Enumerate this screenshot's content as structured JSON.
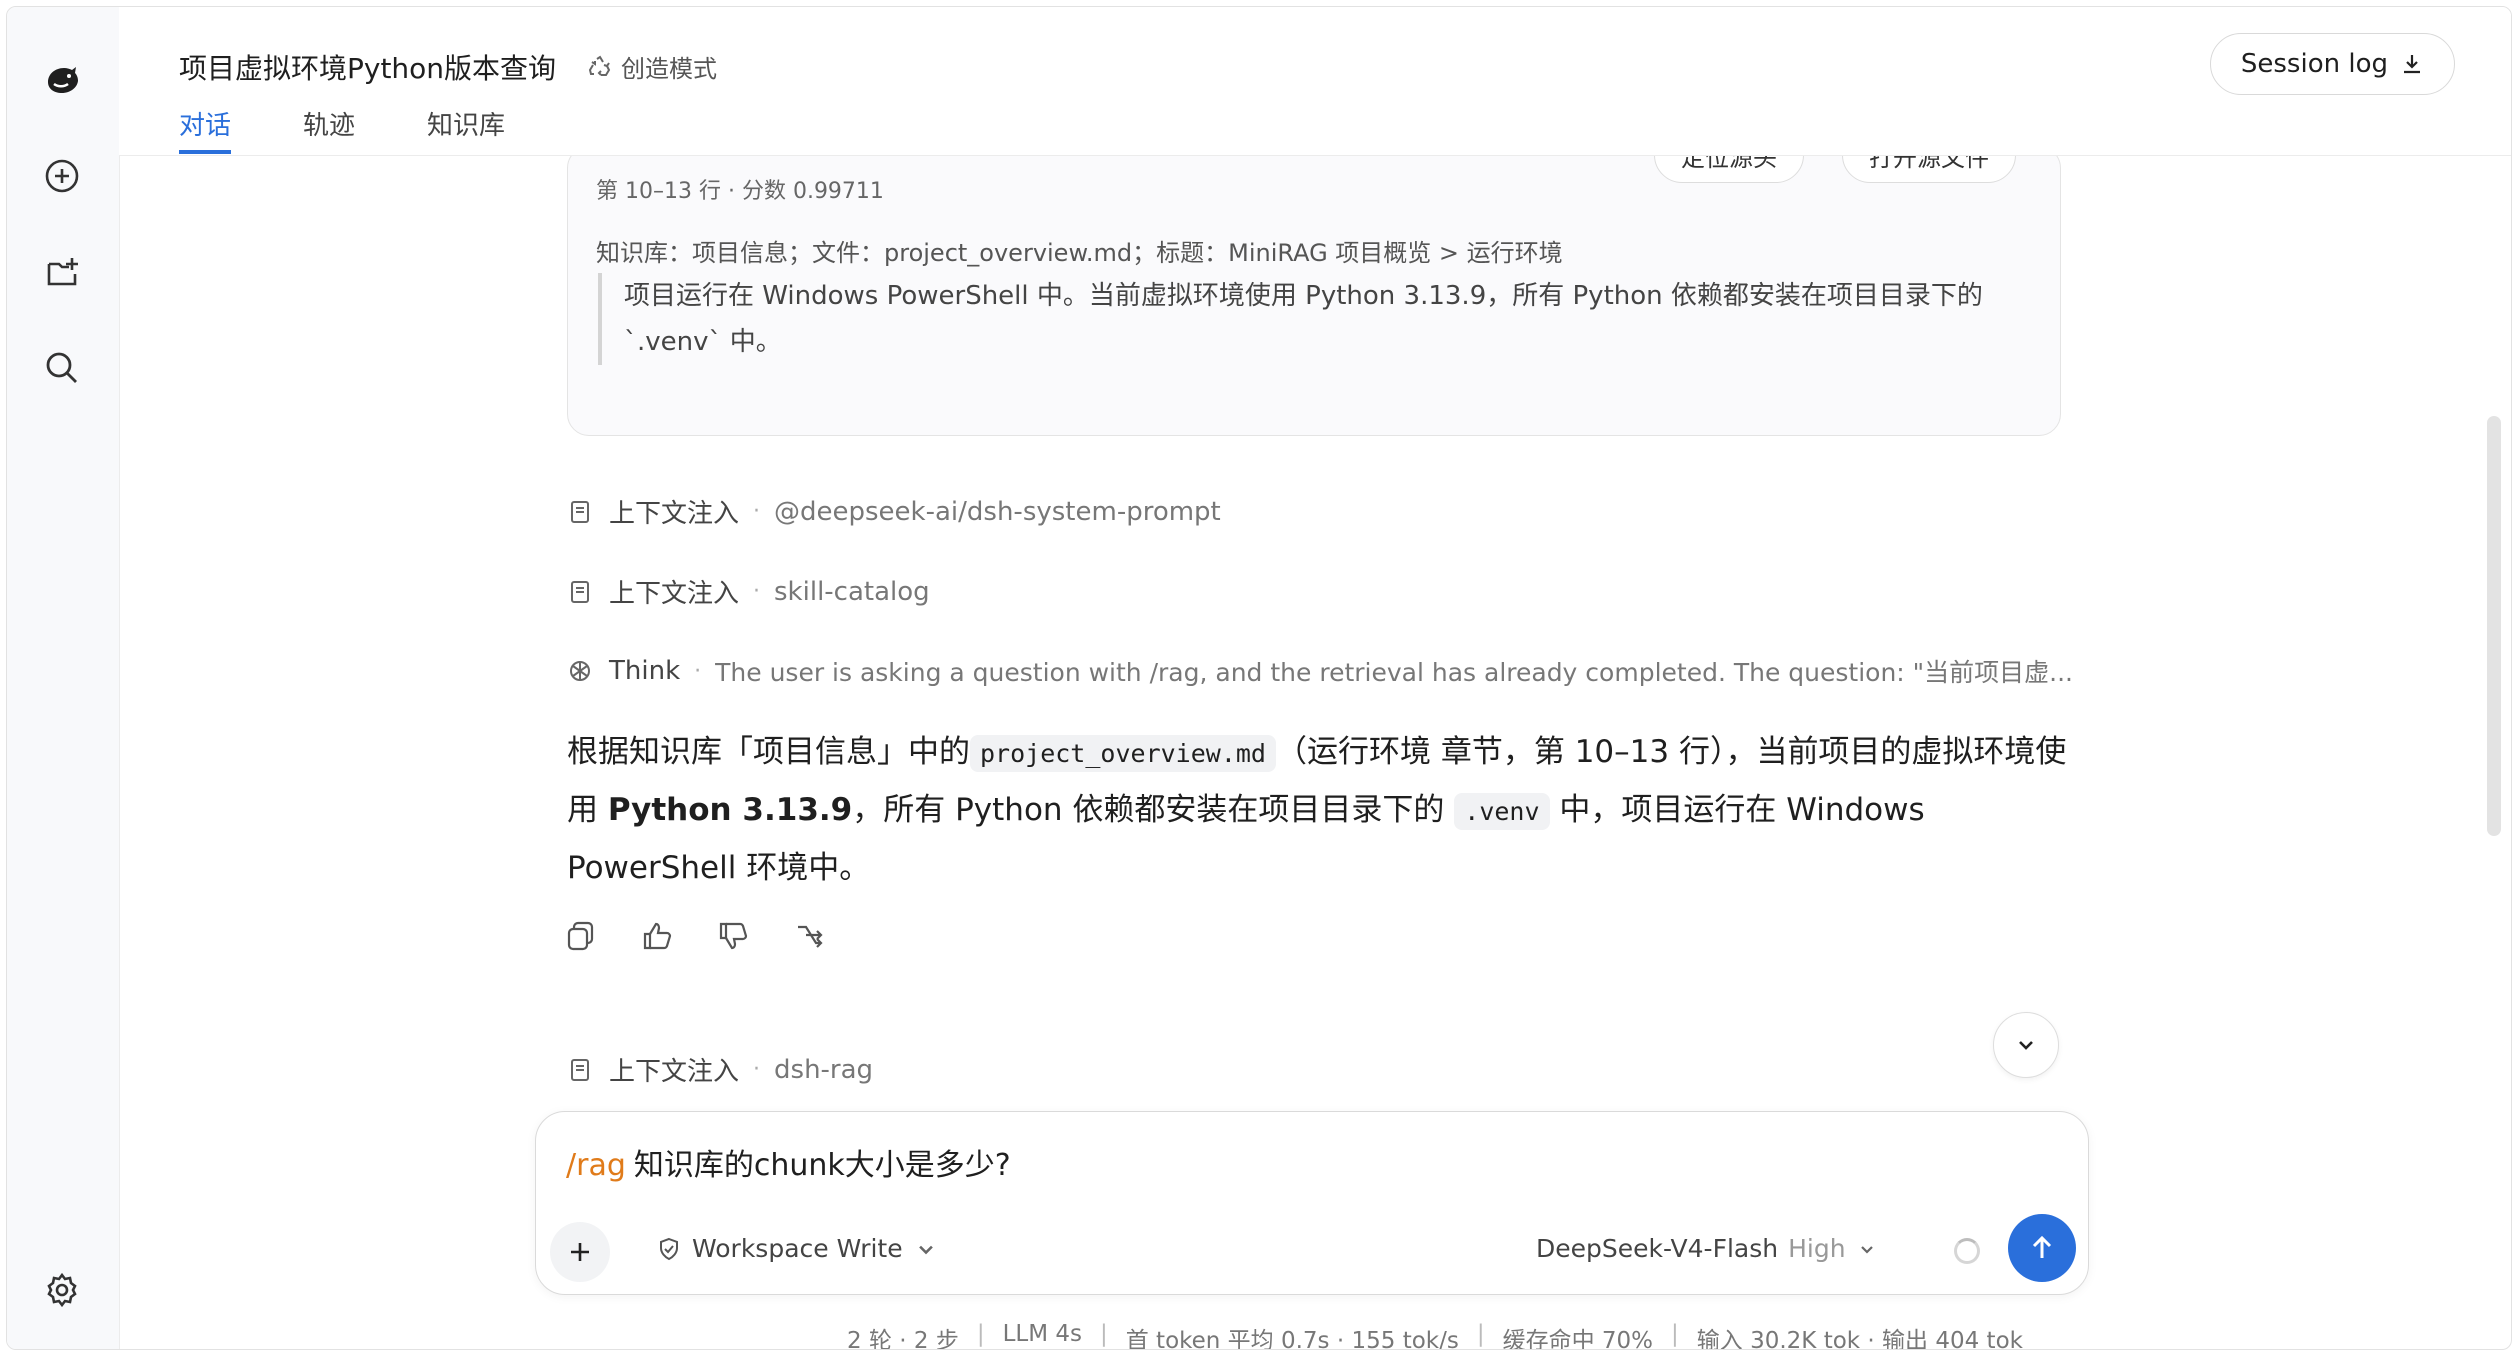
{
  "header": {
    "title": "项目虚拟环境Python版本查询",
    "mode": "创造模式",
    "tabs": [
      "对话",
      "轨迹",
      "知识库"
    ],
    "session_log": "Session log"
  },
  "chunk": {
    "buttons": [
      "定位源头",
      "打开源文件"
    ],
    "meta": "第 10–13 行 · 分数 0.99711",
    "source": "知识库：项目信息；文件：project_overview.md；标题：MiniRAG 项目概览 > 运行环境",
    "quote": "项目运行在 Windows PowerShell 中。当前虚拟环境使用 Python 3.13.9，所有 Python 依赖都安装在项目目录下的 `.venv` 中。"
  },
  "context_rows": [
    {
      "label": "上下文注入",
      "value": "@deepseek-ai/dsh-system-prompt"
    },
    {
      "label": "上下文注入",
      "value": "skill-catalog"
    }
  ],
  "think": {
    "label": "Think",
    "text": "The user is asking a question with /rag, and the retrieval has already completed. The question: \"当前项目虚..."
  },
  "answer": {
    "p1": "根据知识库「项目信息」中的",
    "code1": "project_overview.md",
    "p2": "（运行环境 章节，第 10–13 行），当前项目的虚拟环境使用",
    "bold": "Python 3.13.9",
    "p3": "，所有 Python 依赖都安装在项目目录下的",
    "code2": ".venv",
    "p4": "中，项目运行在 Windows PowerShell 环境中。"
  },
  "last_context": {
    "label": "上下文注入",
    "value": "dsh-rag"
  },
  "composer": {
    "command": "/rag",
    "text": "知识库的chunk大小是多少?",
    "workspace": "Workspace Write",
    "model": "DeepSeek-V4-Flash",
    "effort": "High"
  },
  "stats": [
    "2 轮 · 2 步",
    "LLM 4s",
    "首 token 平均 0.7s · 155 tok/s",
    "缓存命中 70%",
    "输入 30.2K tok · 输出 404 tok"
  ],
  "colors": {
    "accent": "#2a6fdb",
    "command": "#e07b1a"
  }
}
